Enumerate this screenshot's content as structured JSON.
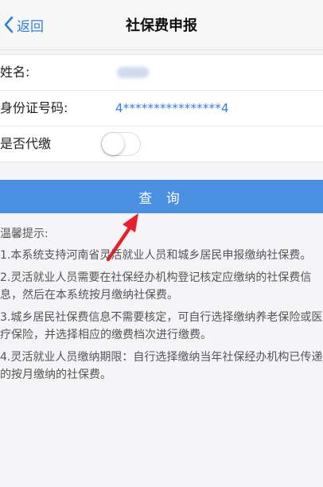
{
  "nav": {
    "back_label": "返回",
    "title": "社保费申报"
  },
  "form": {
    "name_label": "姓名:",
    "id_label": "身份证号码:",
    "id_value": "4****************4",
    "proxy_label": "是否代缴",
    "proxy_enabled": false
  },
  "query_button": "查 询",
  "tips": {
    "heading": "温馨提示:",
    "items": [
      "1.本系统支持河南省灵活就业人员和城乡居民申报缴纳社保费。",
      "2.灵活就业人员需要在社保经办机构登记核定应缴纳的社保费信息，然后在本系统按月缴纳社保费。",
      "3.城乡居民社保费信息不需要核定，可自行选择缴纳养老保险或医疗保险，并选择相应的缴费档次进行缴费。",
      "4.灵活就业人员缴纳期限：自行选择缴纳当年社保经办机构已传递的按月缴纳的社保费。"
    ]
  },
  "colors": {
    "accent": "#2f7ee8",
    "button": "#4a90e2",
    "arrow": "#e8202a"
  }
}
